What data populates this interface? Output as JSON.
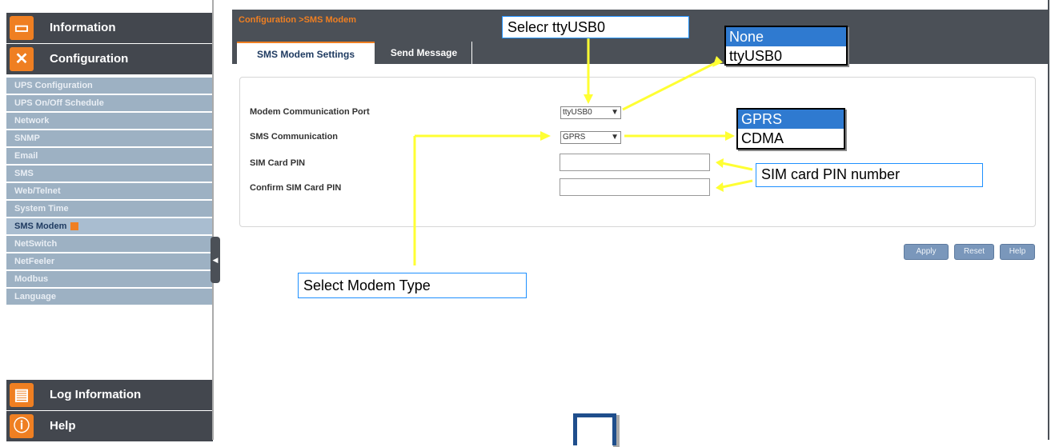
{
  "sidebar": {
    "sections": [
      {
        "label": "Information",
        "icon": "information-icon"
      },
      {
        "label": "Configuration",
        "icon": "configuration-icon"
      },
      {
        "label": "Log Information",
        "icon": "log-information-icon"
      },
      {
        "label": "Help",
        "icon": "help-icon"
      }
    ],
    "config_items": [
      "UPS Configuration",
      "UPS On/Off Schedule",
      "Network",
      "SNMP",
      "Email",
      "SMS",
      "Web/Telnet",
      "System Time",
      "SMS Modem",
      "NetSwitch",
      "NetFeeler",
      "Modbus",
      "Language"
    ],
    "active_item": "SMS Modem"
  },
  "header": {
    "breadcrumb": "Configuration >SMS Modem",
    "tabs": [
      "SMS Modem Settings",
      "Send Message"
    ],
    "active_tab": "SMS Modem Settings"
  },
  "form": {
    "port_label": "Modem Communication Port",
    "port_value": "ttyUSB0",
    "sms_label": "SMS Communication",
    "sms_value": "GPRS",
    "pin_label": "SIM Card PIN",
    "confirm_label": "Confirm SIM Card PIN"
  },
  "buttons": {
    "apply": "Apply",
    "reset": "Reset",
    "help": "Help"
  },
  "annotations": {
    "select_port": "Selecr ttyUSB0",
    "port_options": [
      "None",
      "ttyUSB0"
    ],
    "sms_options": [
      "GPRS",
      "CDMA"
    ],
    "pin_note": "SIM card PIN number",
    "modem_type": "Select Modem Type"
  },
  "colors": {
    "accent": "#ef7f22",
    "header": "#4b5057",
    "sidebar_item": "#9db1c3",
    "arrow": "#ffff33",
    "button": "#7a97bb"
  }
}
